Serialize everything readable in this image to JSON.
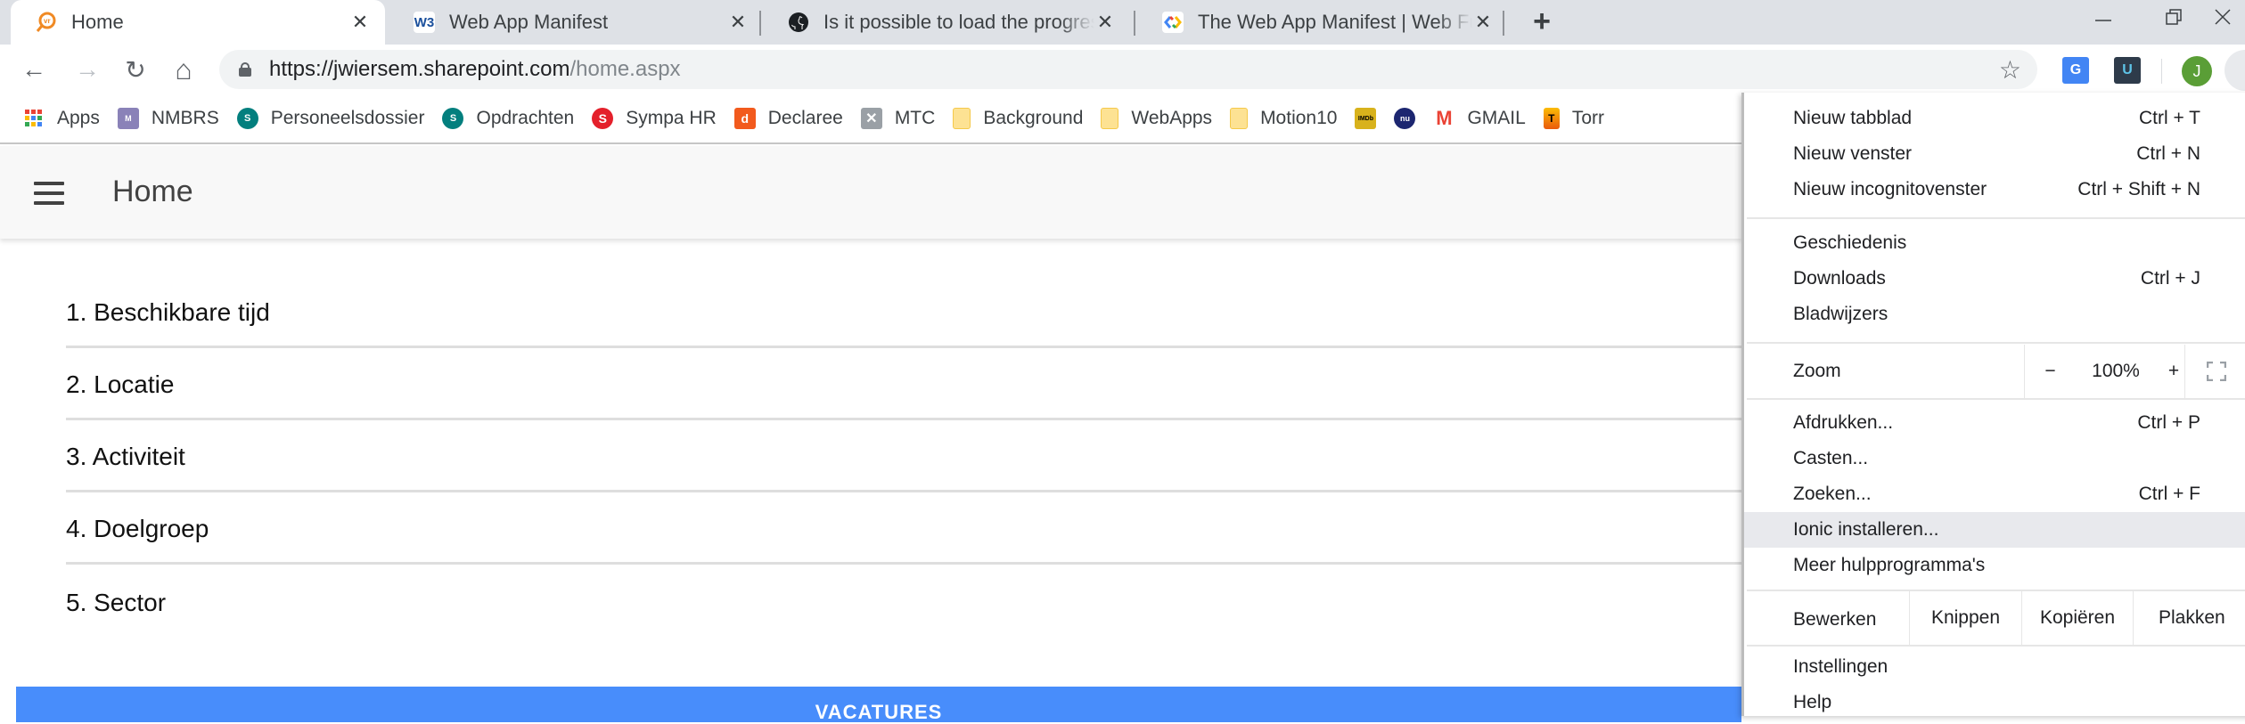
{
  "tabs": [
    {
      "title": "Home",
      "favicon": "vr-magnifier-icon",
      "active": true
    },
    {
      "title": "Web App Manifest",
      "favicon": "w3c-icon",
      "active": false
    },
    {
      "title": "Is it possible to load the progress",
      "favicon": "github-icon",
      "active": false
    },
    {
      "title": "The Web App Manifest  |  Web Fu",
      "favicon": "web-fundamentals-icon",
      "active": false
    }
  ],
  "tab_close_glyph": "✕",
  "new_tab_glyph": "+",
  "window": {
    "minimize": "—",
    "maximize": "❐",
    "close": "✕"
  },
  "toolbar": {
    "back": "←",
    "forward": "→",
    "reload": "↻",
    "home": "⌂",
    "url_host": "https://jwiersem.sharepoint.com",
    "url_path": "/home.aspx",
    "star": "☆",
    "avatar_initial": "J"
  },
  "bookmarks": [
    {
      "label": "Apps",
      "icon": "apps-grid-icon"
    },
    {
      "label": "NMBRS",
      "icon": "nmbrs-icon"
    },
    {
      "label": "Personeelsdossier",
      "icon": "sharepoint-icon"
    },
    {
      "label": "Opdrachten",
      "icon": "sharepoint-icon"
    },
    {
      "label": "Sympa HR",
      "icon": "sympa-icon"
    },
    {
      "label": "Declaree",
      "icon": "declaree-icon"
    },
    {
      "label": "MTC",
      "icon": "mtc-icon"
    },
    {
      "label": "Background",
      "icon": "folder-icon"
    },
    {
      "label": "WebApps",
      "icon": "folder-icon"
    },
    {
      "label": "Motion10",
      "icon": "folder-icon"
    },
    {
      "label": "",
      "icon": "imdb-icon"
    },
    {
      "label": "",
      "icon": "nu-icon"
    },
    {
      "label": "GMAIL",
      "icon": "gmail-icon"
    },
    {
      "label": "Torr",
      "icon": "torrent-icon"
    }
  ],
  "app": {
    "title": "Home",
    "list": [
      "1. Beschikbare tijd",
      "2. Locatie",
      "3. Activiteit",
      "4. Doelgroep",
      "5. Sector"
    ],
    "primary_button": "VACATURES"
  },
  "menu": {
    "items": [
      {
        "label": "Nieuw tabblad",
        "shortcut": "Ctrl + T"
      },
      {
        "label": "Nieuw venster",
        "shortcut": "Ctrl + N"
      },
      {
        "label": "Nieuw incognitovenster",
        "shortcut": "Ctrl + Shift + N"
      },
      {
        "label": "Geschiedenis",
        "shortcut": ""
      },
      {
        "label": "Downloads",
        "shortcut": "Ctrl + J"
      },
      {
        "label": "Bladwijzers",
        "shortcut": ""
      },
      {
        "label": "Afdrukken...",
        "shortcut": "Ctrl + P"
      },
      {
        "label": "Casten...",
        "shortcut": ""
      },
      {
        "label": "Zoeken...",
        "shortcut": "Ctrl + F"
      },
      {
        "label": "Ionic installeren...",
        "shortcut": ""
      },
      {
        "label": "Meer hulpprogramma's",
        "shortcut": ""
      },
      {
        "label": "Instellingen",
        "shortcut": ""
      },
      {
        "label": "Help",
        "shortcut": ""
      }
    ],
    "zoom": {
      "label": "Zoom",
      "minus": "−",
      "value": "100%",
      "plus": "+"
    },
    "edit": {
      "label": "Bewerken",
      "cut": "Knippen",
      "copy": "Kopiëren",
      "paste": "Plakken"
    }
  },
  "colors": {
    "accent_button": "#488dfb",
    "avatar": "#5a9e36",
    "tabstrip": "#dee1e6",
    "menu_highlight": "#e8e9ed"
  }
}
